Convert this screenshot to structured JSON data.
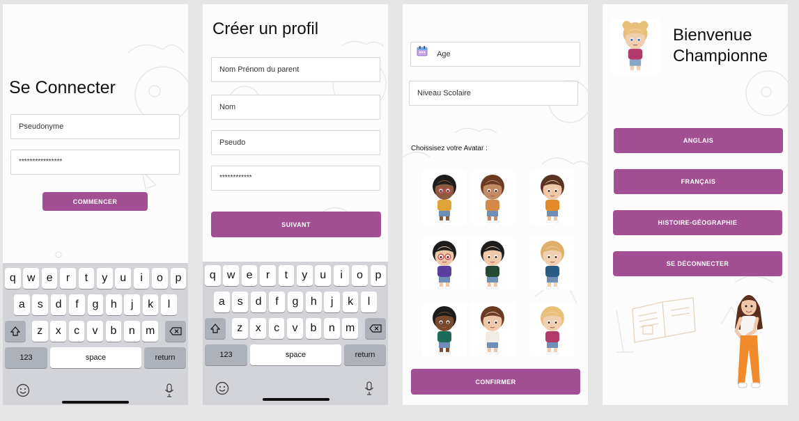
{
  "login": {
    "title": "Se Connecter",
    "pseudo_placeholder": "Pseudonyme",
    "password_value": "****************",
    "start_button": "COMMENCER"
  },
  "create_profile": {
    "title": "Créer un profil",
    "parent_name_placeholder": "Nom Prénom  du parent",
    "name_placeholder": "Nom",
    "pseudo_placeholder": "Pseudo",
    "password_value": "************",
    "next_button": "SUIVANT"
  },
  "avatar_screen": {
    "age_placeholder": "Age",
    "school_level_placeholder": "Niveau Scolaire",
    "choose_label": "Choissisez votre Avatar :",
    "confirm_button": "CONFIRMER",
    "avatars": [
      {
        "hair": "#1c1c1c",
        "skin": "#8a5a3c",
        "shirt": "#e0a33a",
        "glasses": true
      },
      {
        "hair": "#6b3a22",
        "skin": "#c48a63",
        "shirt": "#d58a4a",
        "glasses": false
      },
      {
        "hair": "#5a3322",
        "skin": "#f0c8a8",
        "shirt": "#e38a2a",
        "glasses": false
      },
      {
        "hair": "#1c1c1c",
        "skin": "#f0c8a8",
        "shirt": "#5b3fa0",
        "glasses": true
      },
      {
        "hair": "#1c1c1c",
        "skin": "#f0c8a8",
        "shirt": "#244a36",
        "glasses": false
      },
      {
        "hair": "#e0b06a",
        "skin": "#f2cfb0",
        "shirt": "#2a5c84",
        "glasses": false
      },
      {
        "hair": "#1c1c1c",
        "skin": "#7a4a2e",
        "shirt": "#1f6b5a",
        "glasses": false
      },
      {
        "hair": "#6b3a22",
        "skin": "#f0c8a8",
        "shirt": "#f2ede4",
        "glasses": false
      },
      {
        "hair": "#e8c07a",
        "skin": "#f2cfb0",
        "shirt": "#b23a6a",
        "glasses": false
      }
    ]
  },
  "welcome": {
    "line1": "Bienvenue",
    "line2": "Championne",
    "subjects": [
      "ANGLAIS",
      "FRANÇAIS",
      "HISTOIRE-GÉOGRAPHIE"
    ],
    "logout_button": "SE DÉCONNECTER"
  },
  "keyboard": {
    "row1": [
      "q",
      "w",
      "e",
      "r",
      "t",
      "y",
      "u",
      "i",
      "o",
      "p"
    ],
    "row2": [
      "a",
      "s",
      "d",
      "f",
      "g",
      "h",
      "j",
      "k",
      "l"
    ],
    "row3": [
      "z",
      "x",
      "c",
      "v",
      "b",
      "n",
      "m"
    ],
    "numbers_key": "123",
    "space_key": "space",
    "return_key": "return"
  },
  "colors": {
    "accent": "#a24f93",
    "keyboard_bg": "#d2d4d9",
    "key_dark": "#adb1ba"
  }
}
